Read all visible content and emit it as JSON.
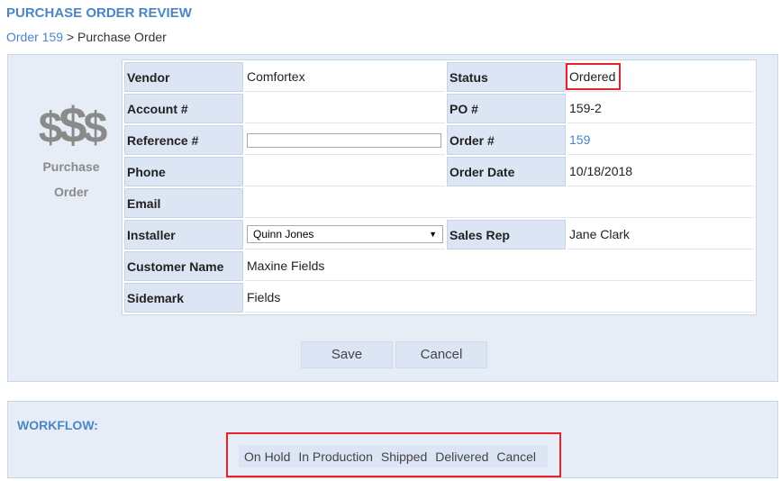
{
  "header": {
    "title": "PURCHASE ORDER REVIEW",
    "breadcrumb_link": "Order 159",
    "breadcrumb_sep": ">",
    "breadcrumb_current": "Purchase Order"
  },
  "logo": {
    "dollars": [
      "$",
      "$",
      "$"
    ],
    "line1": "Purchase",
    "line2": "Order"
  },
  "form": {
    "vendor_label": "Vendor",
    "vendor_value": "Comfortex",
    "status_label": "Status",
    "status_value": "Ordered",
    "account_label": "Account #",
    "account_value": "",
    "po_label": "PO #",
    "po_value": "159-2",
    "reference_label": "Reference #",
    "reference_value": "",
    "order_label": "Order #",
    "order_value": "159",
    "phone_label": "Phone",
    "phone_value": "",
    "order_date_label": "Order Date",
    "order_date_value": "10/18/2018",
    "email_label": "Email",
    "email_value": "",
    "installer_label": "Installer",
    "installer_value": "Quinn Jones",
    "sales_rep_label": "Sales Rep",
    "sales_rep_value": "Jane Clark",
    "customer_label": "Customer Name",
    "customer_value": "Maxine Fields",
    "sidemark_label": "Sidemark",
    "sidemark_value": "Fields"
  },
  "buttons": {
    "save": "Save",
    "cancel": "Cancel"
  },
  "workflow": {
    "title": "WORKFLOW:",
    "items": [
      "On Hold",
      "In Production",
      "Shipped",
      "Delivered",
      "Cancel"
    ]
  },
  "colors": {
    "accent": "#4a86c5",
    "panel_bg": "#e6edf6",
    "label_bg": "#dbe5f3",
    "highlight": "#e8202a"
  }
}
